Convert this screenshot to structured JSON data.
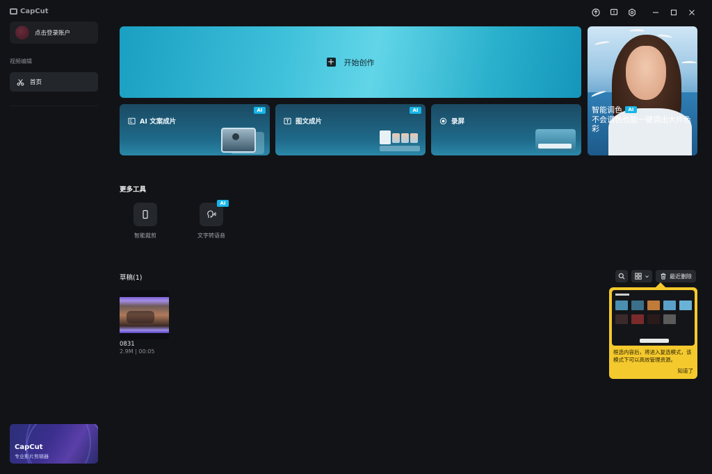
{
  "app": {
    "name": "CapCut"
  },
  "titlebar": {
    "icons": [
      "upload-icon",
      "feedback-icon",
      "settings-icon",
      "minimize-icon",
      "maximize-icon",
      "close-icon"
    ]
  },
  "sidebar": {
    "login_label": "点击登录账户",
    "section_label": "视频编辑",
    "nav_home": "首页",
    "promo_title": "CapCut",
    "promo_subtitle": "专业影片剪辑器"
  },
  "hero": {
    "label": "开始创作"
  },
  "features": [
    {
      "label": "AI 文案成片",
      "badge": "AI"
    },
    {
      "label": "图文成片",
      "badge": "AI"
    },
    {
      "label": "录屏"
    }
  ],
  "photo_card": {
    "title": "智能调色",
    "badge": "AI",
    "subtitle": "不会调色也能一键调出大片色彩"
  },
  "more_tools": {
    "title": "更多工具",
    "items": [
      {
        "label": "智能裁剪"
      },
      {
        "label": "文字转语音",
        "badge": "AI"
      }
    ]
  },
  "drafts": {
    "title": "草稿(1)",
    "recent_delete": "最近删除",
    "items": [
      {
        "name": "0831",
        "meta": "2.9M | 00:05"
      }
    ]
  },
  "tooltip": {
    "text": "框选内容后，将进入复选模式，该模式下可以高效管理资源。",
    "confirm": "知道了"
  },
  "colors": {
    "background": "#121317",
    "accent": "#17b6e9",
    "tooltip": "#f4c92d",
    "hero": "#3ec0da"
  }
}
